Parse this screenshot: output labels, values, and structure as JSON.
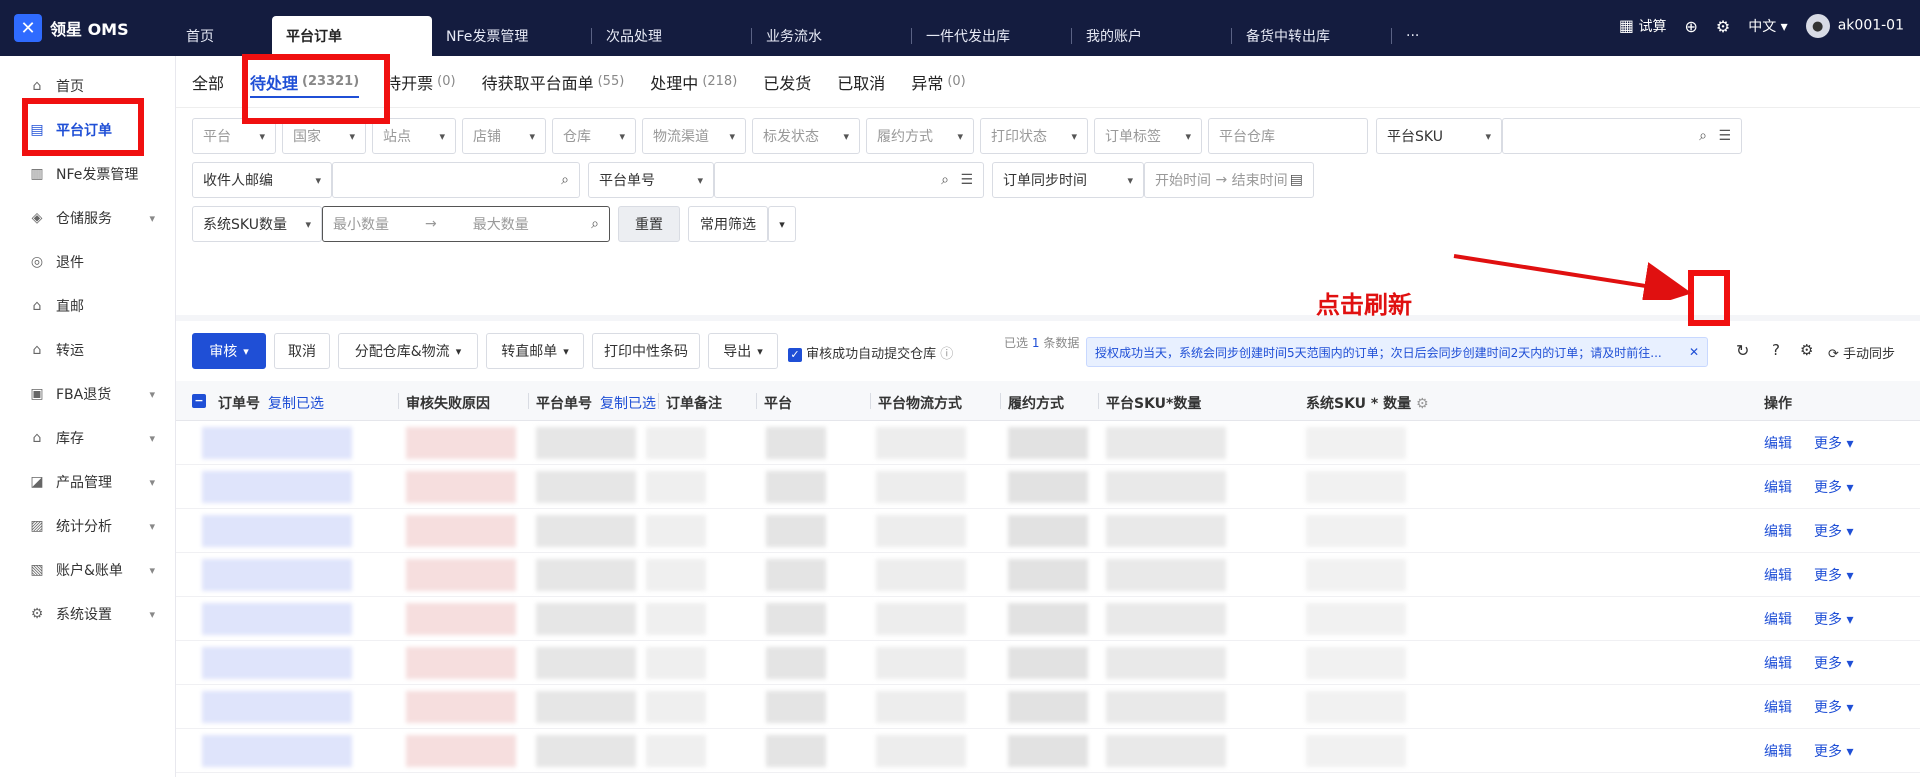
{
  "brand": {
    "name": "领星 OMS"
  },
  "topnav": [
    "首页",
    "平台订单",
    "NFe发票管理",
    "次品处理",
    "业务流水",
    "一件代发出库",
    "我的账户",
    "备货中转出库"
  ],
  "topnav_more": "···",
  "topright": {
    "trial": "试算",
    "language": "中文",
    "user": "ak001-01"
  },
  "sidebar": [
    "首页",
    "平台订单",
    "NFe发票管理",
    "仓储服务",
    "退件",
    "直邮",
    "转运",
    "FBA退货",
    "库存",
    "产品管理",
    "统计分析",
    "账户&账单",
    "系统设置"
  ],
  "tabs": [
    {
      "label": "全部",
      "count": ""
    },
    {
      "label": "待处理",
      "count": "(23321)"
    },
    {
      "label": "待开票",
      "count": "(0)"
    },
    {
      "label": "待获取平台面单",
      "count": "(55)"
    },
    {
      "label": "处理中",
      "count": "(218)"
    },
    {
      "label": "已发货",
      "count": ""
    },
    {
      "label": "已取消",
      "count": ""
    },
    {
      "label": "异常",
      "count": "(0)"
    }
  ],
  "filters": {
    "row1": [
      "平台",
      "国家",
      "站点",
      "店铺",
      "仓库",
      "物流渠道",
      "标发状态",
      "履约方式",
      "打印状态",
      "订单标签"
    ],
    "platform_warehouse": "平台仓库",
    "platform_sku": "平台SKU",
    "recipient_zip": "收件人邮编",
    "platform_order_no": "平台单号",
    "sync_time": "订单同步时间",
    "start_time": "开始时间",
    "end_time": "结束时间",
    "sys_sku_qty": "系统SKU数量",
    "min_qty": "最小数量",
    "max_qty": "最大数量",
    "reset": "重置",
    "common_filter": "常用筛选"
  },
  "toolbar": {
    "review": "审核",
    "cancel": "取消",
    "assign": "分配仓库&物流",
    "to_direct": "转直邮单",
    "print_barcode": "打印中性条码",
    "export": "导出",
    "auto_submit": "审核成功自动提交仓库",
    "selected_prefix": "已选",
    "selected_count": "1",
    "selected_suffix": "条数据",
    "notice": "授权成功当天，系统会同步创建时间5天范围内的订单；次日后会同步创建时间2天内的订单；请及时前往...",
    "manual_sync": "手动同步",
    "annotation": "点击刷新"
  },
  "table": {
    "headers": [
      "订单号",
      "审核失败原因",
      "平台单号",
      "订单备注",
      "平台",
      "平台物流方式",
      "履约方式",
      "平台SKU*数量",
      "系统SKU * 数量",
      "操作"
    ],
    "copy_selected": "复制已选",
    "edit": "编辑",
    "more": "更多"
  }
}
